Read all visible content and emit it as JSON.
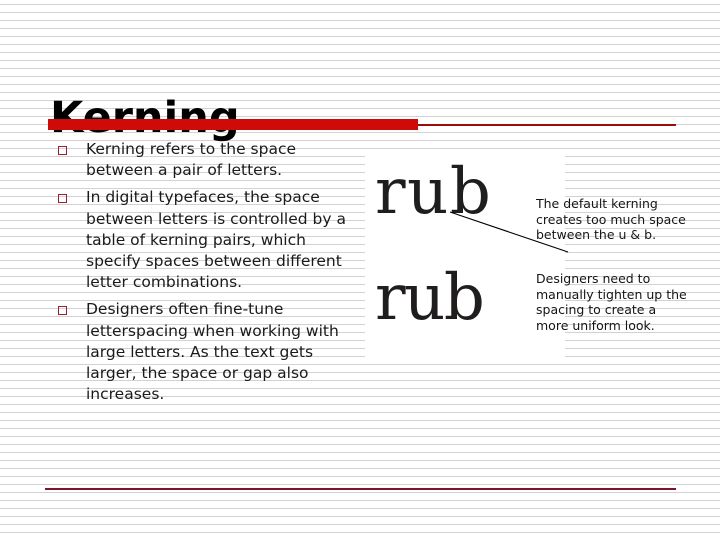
{
  "slide": {
    "title": "Kerning",
    "theme": {
      "accent_bar": "#ce0b08",
      "accent_rule": "#9e0b0b",
      "bottom_rule": "#7d1526",
      "bullet_marker": "#9a2036",
      "background": "#ffffff",
      "stripe": "#d2d2d4",
      "text": "#1a1a1a"
    },
    "bullets": [
      {
        "marker": "square-bullet-icon",
        "text": "Kerning refers to the space between a pair of letters."
      },
      {
        "marker": "square-bullet-icon",
        "text": "In digital typefaces, the space between letters is controlled by a table of kerning pairs, which specify spaces between different letter combinations."
      },
      {
        "marker": "square-bullet-icon",
        "text": "Designers often fine-tune letterspacing when working with large letters. As the text gets larger, the space or gap also increases."
      }
    ],
    "picture": {
      "name": "kerning-example-image",
      "sample_loose": "rub",
      "sample_tight": "rub",
      "leader_line": "callout-leader-line"
    },
    "callouts": [
      {
        "id": "default-kerning",
        "text": "The default kerning creates too much space between the u & b."
      },
      {
        "id": "designers-tighten",
        "text": "Designers need to manually tighten up the spacing to create a more uniform look."
      }
    ]
  }
}
